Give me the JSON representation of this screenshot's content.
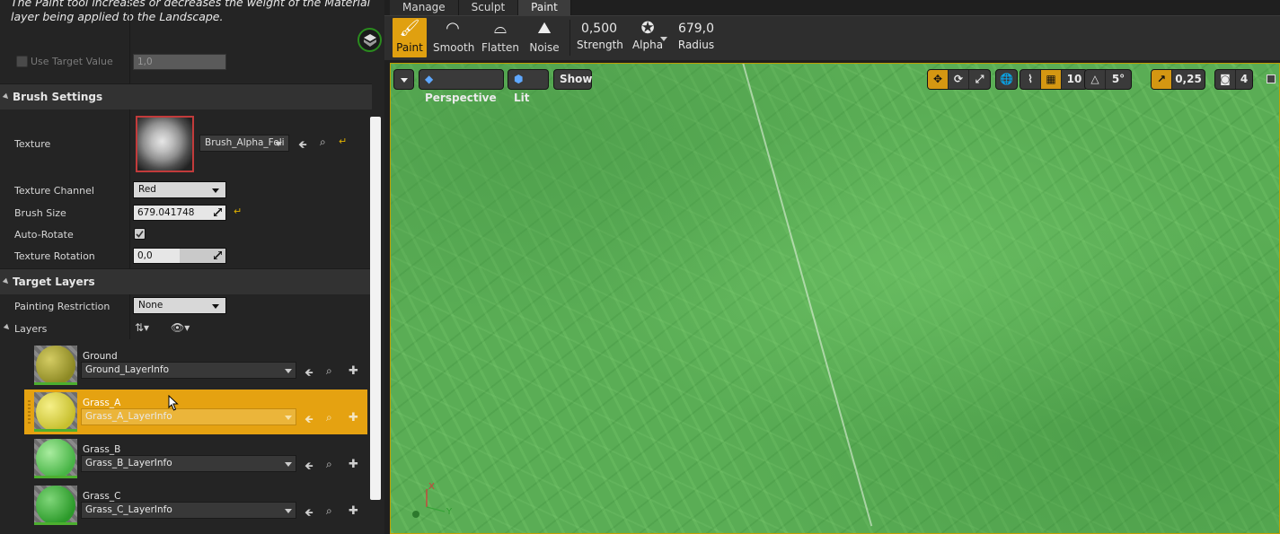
{
  "details": {
    "tooltip": "The Paint tool increases or decreases the weight of the Material layer being applied to the Landscape.",
    "use_target_value": {
      "label": "Use Target Value",
      "value": "1,0"
    },
    "brush_settings": {
      "title": "Brush Settings",
      "texture_label": "Texture",
      "texture_asset": "Brush_Alpha_Foli",
      "texture_channel_label": "Texture Channel",
      "texture_channel_value": "Red",
      "brush_size_label": "Brush Size",
      "brush_size_value": "679.041748",
      "auto_rotate_label": "Auto-Rotate",
      "texture_rotation_label": "Texture Rotation",
      "texture_rotation_value": "0,0"
    },
    "target_layers": {
      "title": "Target Layers",
      "painting_restriction_label": "Painting Restriction",
      "painting_restriction_value": "None",
      "layers_label": "Layers",
      "layers": [
        {
          "name": "Ground",
          "info": "Ground_LayerInfo",
          "color": "#b7b03a"
        },
        {
          "name": "Grass_A",
          "info": "Grass_A_LayerInfo",
          "color": "#e4dc57"
        },
        {
          "name": "Grass_B",
          "info": "Grass_B_LayerInfo",
          "color": "#74d06e"
        },
        {
          "name": "Grass_C",
          "info": "Grass_C_LayerInfo",
          "color": "#45b341"
        }
      ]
    }
  },
  "modes": {
    "tabs": [
      "Manage",
      "Sculpt",
      "Paint"
    ],
    "active": "Paint"
  },
  "tools": [
    "Paint",
    "Smooth",
    "Flatten",
    "Noise"
  ],
  "brush_values": {
    "strength_value": "0,500",
    "strength_label": "Strength",
    "alpha_label": "Alpha",
    "radius_value": "679,0",
    "radius_label": "Radius"
  },
  "viewport": {
    "perspective": "Perspective",
    "lit": "Lit",
    "show": "Show",
    "grid_snap": "10",
    "angle_snap": "5°",
    "scale_snap": "0,25",
    "camera_speed": "4",
    "axis_x": "X",
    "axis_y": "Y",
    "selection_color": "#e5a211",
    "accent_color": "#e0a010"
  }
}
